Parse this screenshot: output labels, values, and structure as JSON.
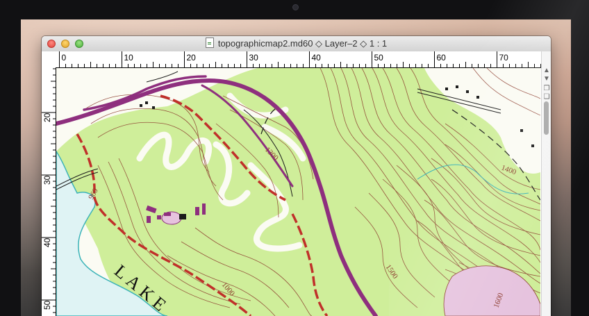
{
  "window": {
    "title": "topographicmap2.md60 ◇ Layer–2 ◇ 1 : 1"
  },
  "ruler_top": {
    "labels": [
      "0",
      "10",
      "20",
      "30",
      "40",
      "50",
      "60",
      "70"
    ]
  },
  "ruler_left": {
    "labels": [
      "20",
      "30",
      "40",
      "50"
    ]
  },
  "map": {
    "lake_label": "LAKE",
    "contour_labels": [
      "960",
      "1000",
      "1300",
      "1400",
      "1500",
      "1600"
    ]
  },
  "colors": {
    "vegetation": "#cfee9a",
    "water": "#dff3f4",
    "contour": "#8b3a2c",
    "road_red": "#c0302a",
    "highway": "#8e2f7e",
    "built_up": "#e6c3de"
  },
  "icons": {
    "close": "close-dot",
    "minimize": "minimize-dot",
    "zoom": "zoom-dot",
    "document": "document-icon"
  }
}
